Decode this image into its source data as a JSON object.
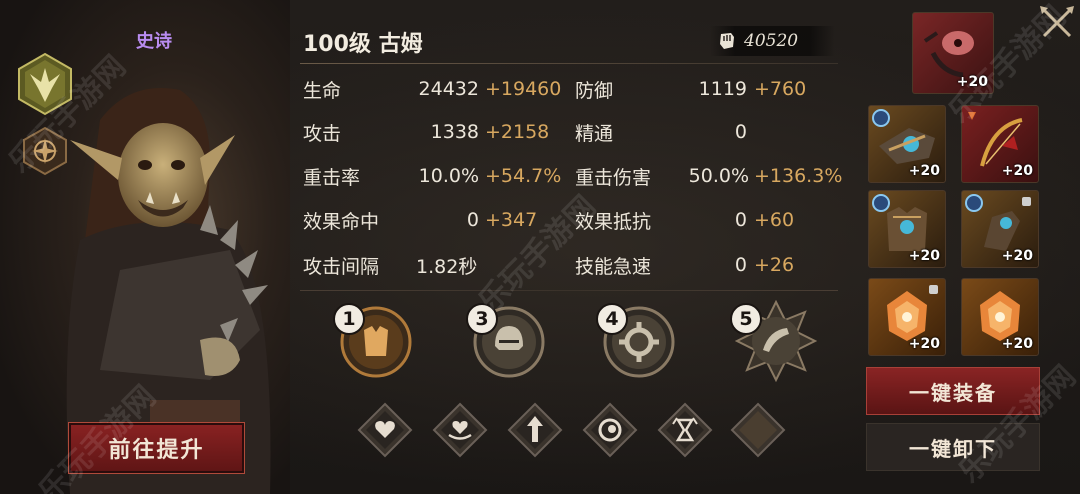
{
  "hero": {
    "rarity": "史诗",
    "title": "100级 古姆",
    "power": "40520",
    "upgrade_label": "前往提升"
  },
  "stats": [
    {
      "label": "生命",
      "base": "24432",
      "bonus": "+19460"
    },
    {
      "label": "防御",
      "base": "1119",
      "bonus": "+760"
    },
    {
      "label": "攻击",
      "base": "1338",
      "bonus": "+2158"
    },
    {
      "label": "精通",
      "base": "0",
      "bonus": ""
    },
    {
      "label": "重击率",
      "base": "10.0%",
      "bonus": "+54.7%"
    },
    {
      "label": "重击伤害",
      "base": "50.0%",
      "bonus": "+136.3%"
    },
    {
      "label": "效果命中",
      "base": "0",
      "bonus": "+347"
    },
    {
      "label": "效果抵抗",
      "base": "0",
      "bonus": "+60"
    },
    {
      "label": "攻击间隔",
      "base": "1.82秒",
      "bonus": ""
    },
    {
      "label": "技能急速",
      "base": "0",
      "bonus": "+26"
    }
  ],
  "skills": [
    {
      "num": "1",
      "icon": "armor-skill-icon"
    },
    {
      "num": "3",
      "icon": "helmet-skill-icon"
    },
    {
      "num": "4",
      "icon": "gear-skill-icon"
    },
    {
      "num": "5",
      "icon": "horn-skill-icon"
    }
  ],
  "runes": [
    "heart-rune-icon",
    "heart-hand-rune-icon",
    "arrow-up-rune-icon",
    "swirl-rune-icon",
    "hourglass-rune-icon",
    "empty-rune-slot"
  ],
  "equipment": [
    {
      "slot": "amulet",
      "plus": "+20"
    },
    {
      "slot": "weapon-left",
      "plus": "+20"
    },
    {
      "slot": "weapon-right",
      "plus": "+20"
    },
    {
      "slot": "armor-left",
      "plus": "+20"
    },
    {
      "slot": "armor-right",
      "plus": "+20"
    },
    {
      "slot": "gem-left",
      "plus": "+20"
    },
    {
      "slot": "gem-right",
      "plus": "+20"
    }
  ],
  "buttons": {
    "equip_all": "一键装备",
    "unequip_all": "一键卸下"
  },
  "watermark": "乐玩手游网",
  "colors": {
    "rarity": "#b98cf0",
    "bonus": "#d8a860",
    "primary_button": "#8a2222"
  }
}
